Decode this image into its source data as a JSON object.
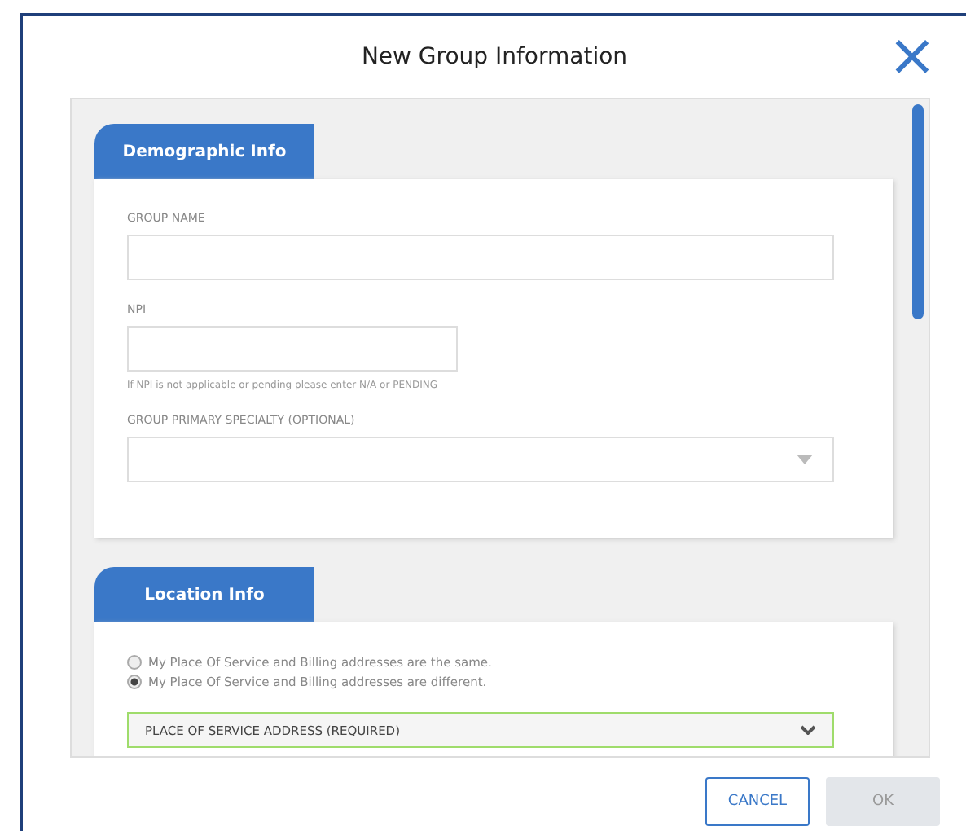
{
  "dialog": {
    "title": "New Group Information",
    "close": "×"
  },
  "sections": [
    {
      "tab": "Demographic Info",
      "fields": [
        {
          "kind": "wide",
          "label": "GROUP NAME"
        },
        {
          "kind": "narrow",
          "label": "NPI",
          "hint": "If NPI is not applicable or pending please enter N/A or PENDING"
        },
        {
          "kind": "select",
          "label": "GROUP PRIMARY SPECIALTY (OPTIONAL)"
        }
      ]
    },
    {
      "tab": "Location Info",
      "radios": [
        {
          "label": "My Place Of Service and Billing addresses are the same.",
          "selected": false
        },
        {
          "label": "My Place Of Service and Billing addresses are different.",
          "selected": true
        }
      ],
      "accordion": {
        "label": "PLACE OF SERVICE ADDRESS (REQUIRED)",
        "expanded": false
      }
    }
  ],
  "buttons": [
    {
      "label": "CANCEL",
      "disabled": false
    },
    {
      "label": "OK",
      "disabled": true
    }
  ]
}
